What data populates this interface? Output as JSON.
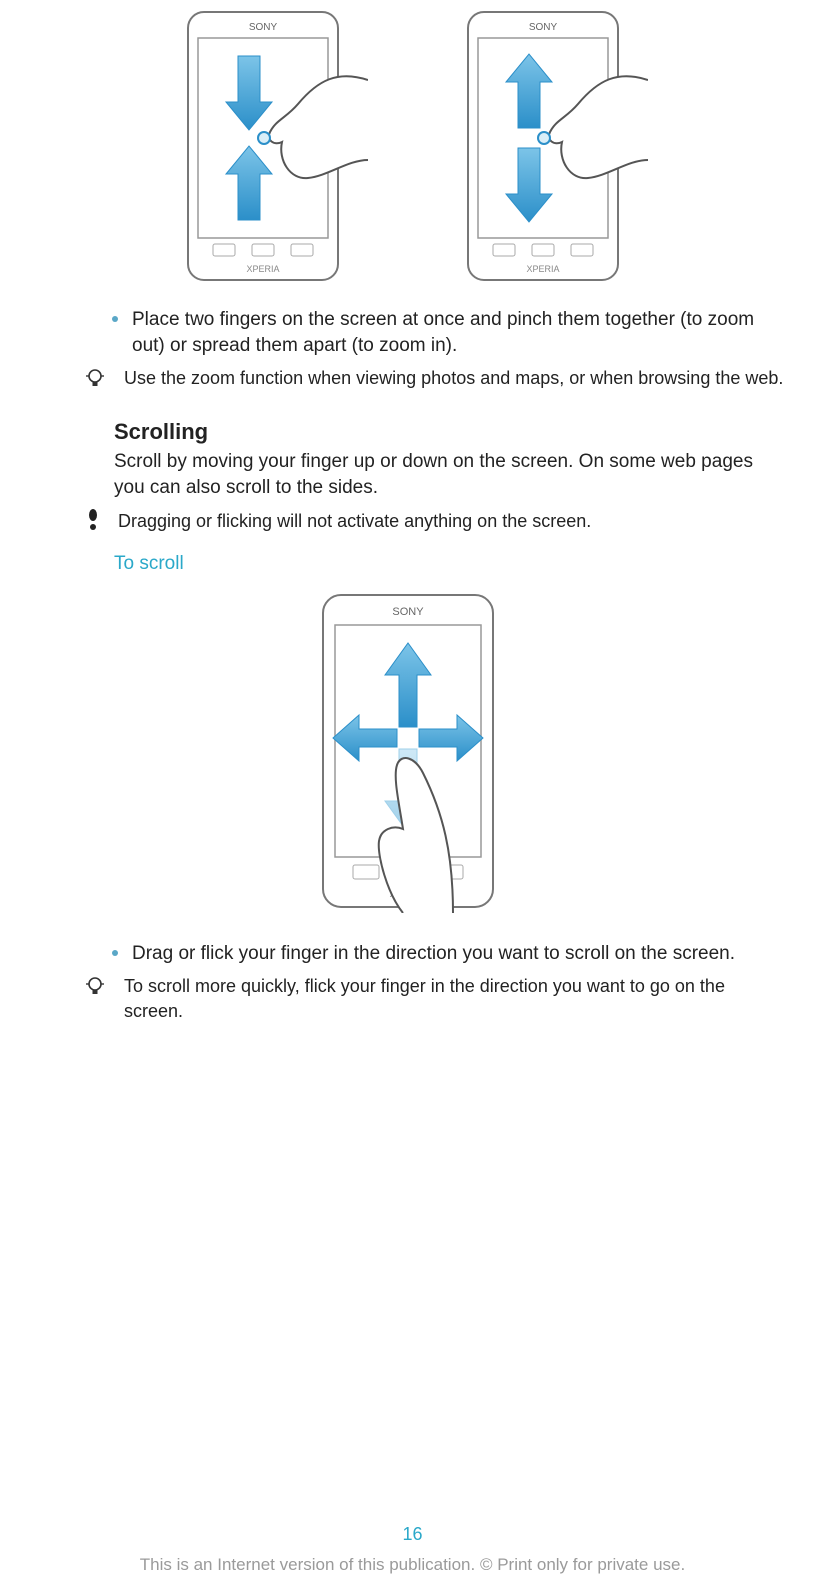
{
  "phones": {
    "brand": "SONY",
    "model": "XPERIA"
  },
  "pinch": {
    "bullet": "Place two fingers on the screen at once and pinch them together (to zoom out) or spread them apart (to zoom in).",
    "tip": "Use the zoom function when viewing photos and maps, or when browsing the web."
  },
  "scrolling": {
    "heading": "Scrolling",
    "para": "Scroll by moving your finger up or down on the screen. On some web pages you can also scroll to the sides.",
    "warn": "Dragging or flicking will not activate anything on the screen.",
    "sub": "To scroll",
    "bullet": "Drag or flick your finger in the direction you want to scroll on the screen.",
    "tip": "To scroll more quickly, flick your finger in the direction you want to go on the screen."
  },
  "footer": {
    "page": "16",
    "legal": "This is an Internet version of this publication. © Print only for private use."
  },
  "colors": {
    "accent": "#2aa8c9",
    "arrow": "#3f9fd8"
  }
}
